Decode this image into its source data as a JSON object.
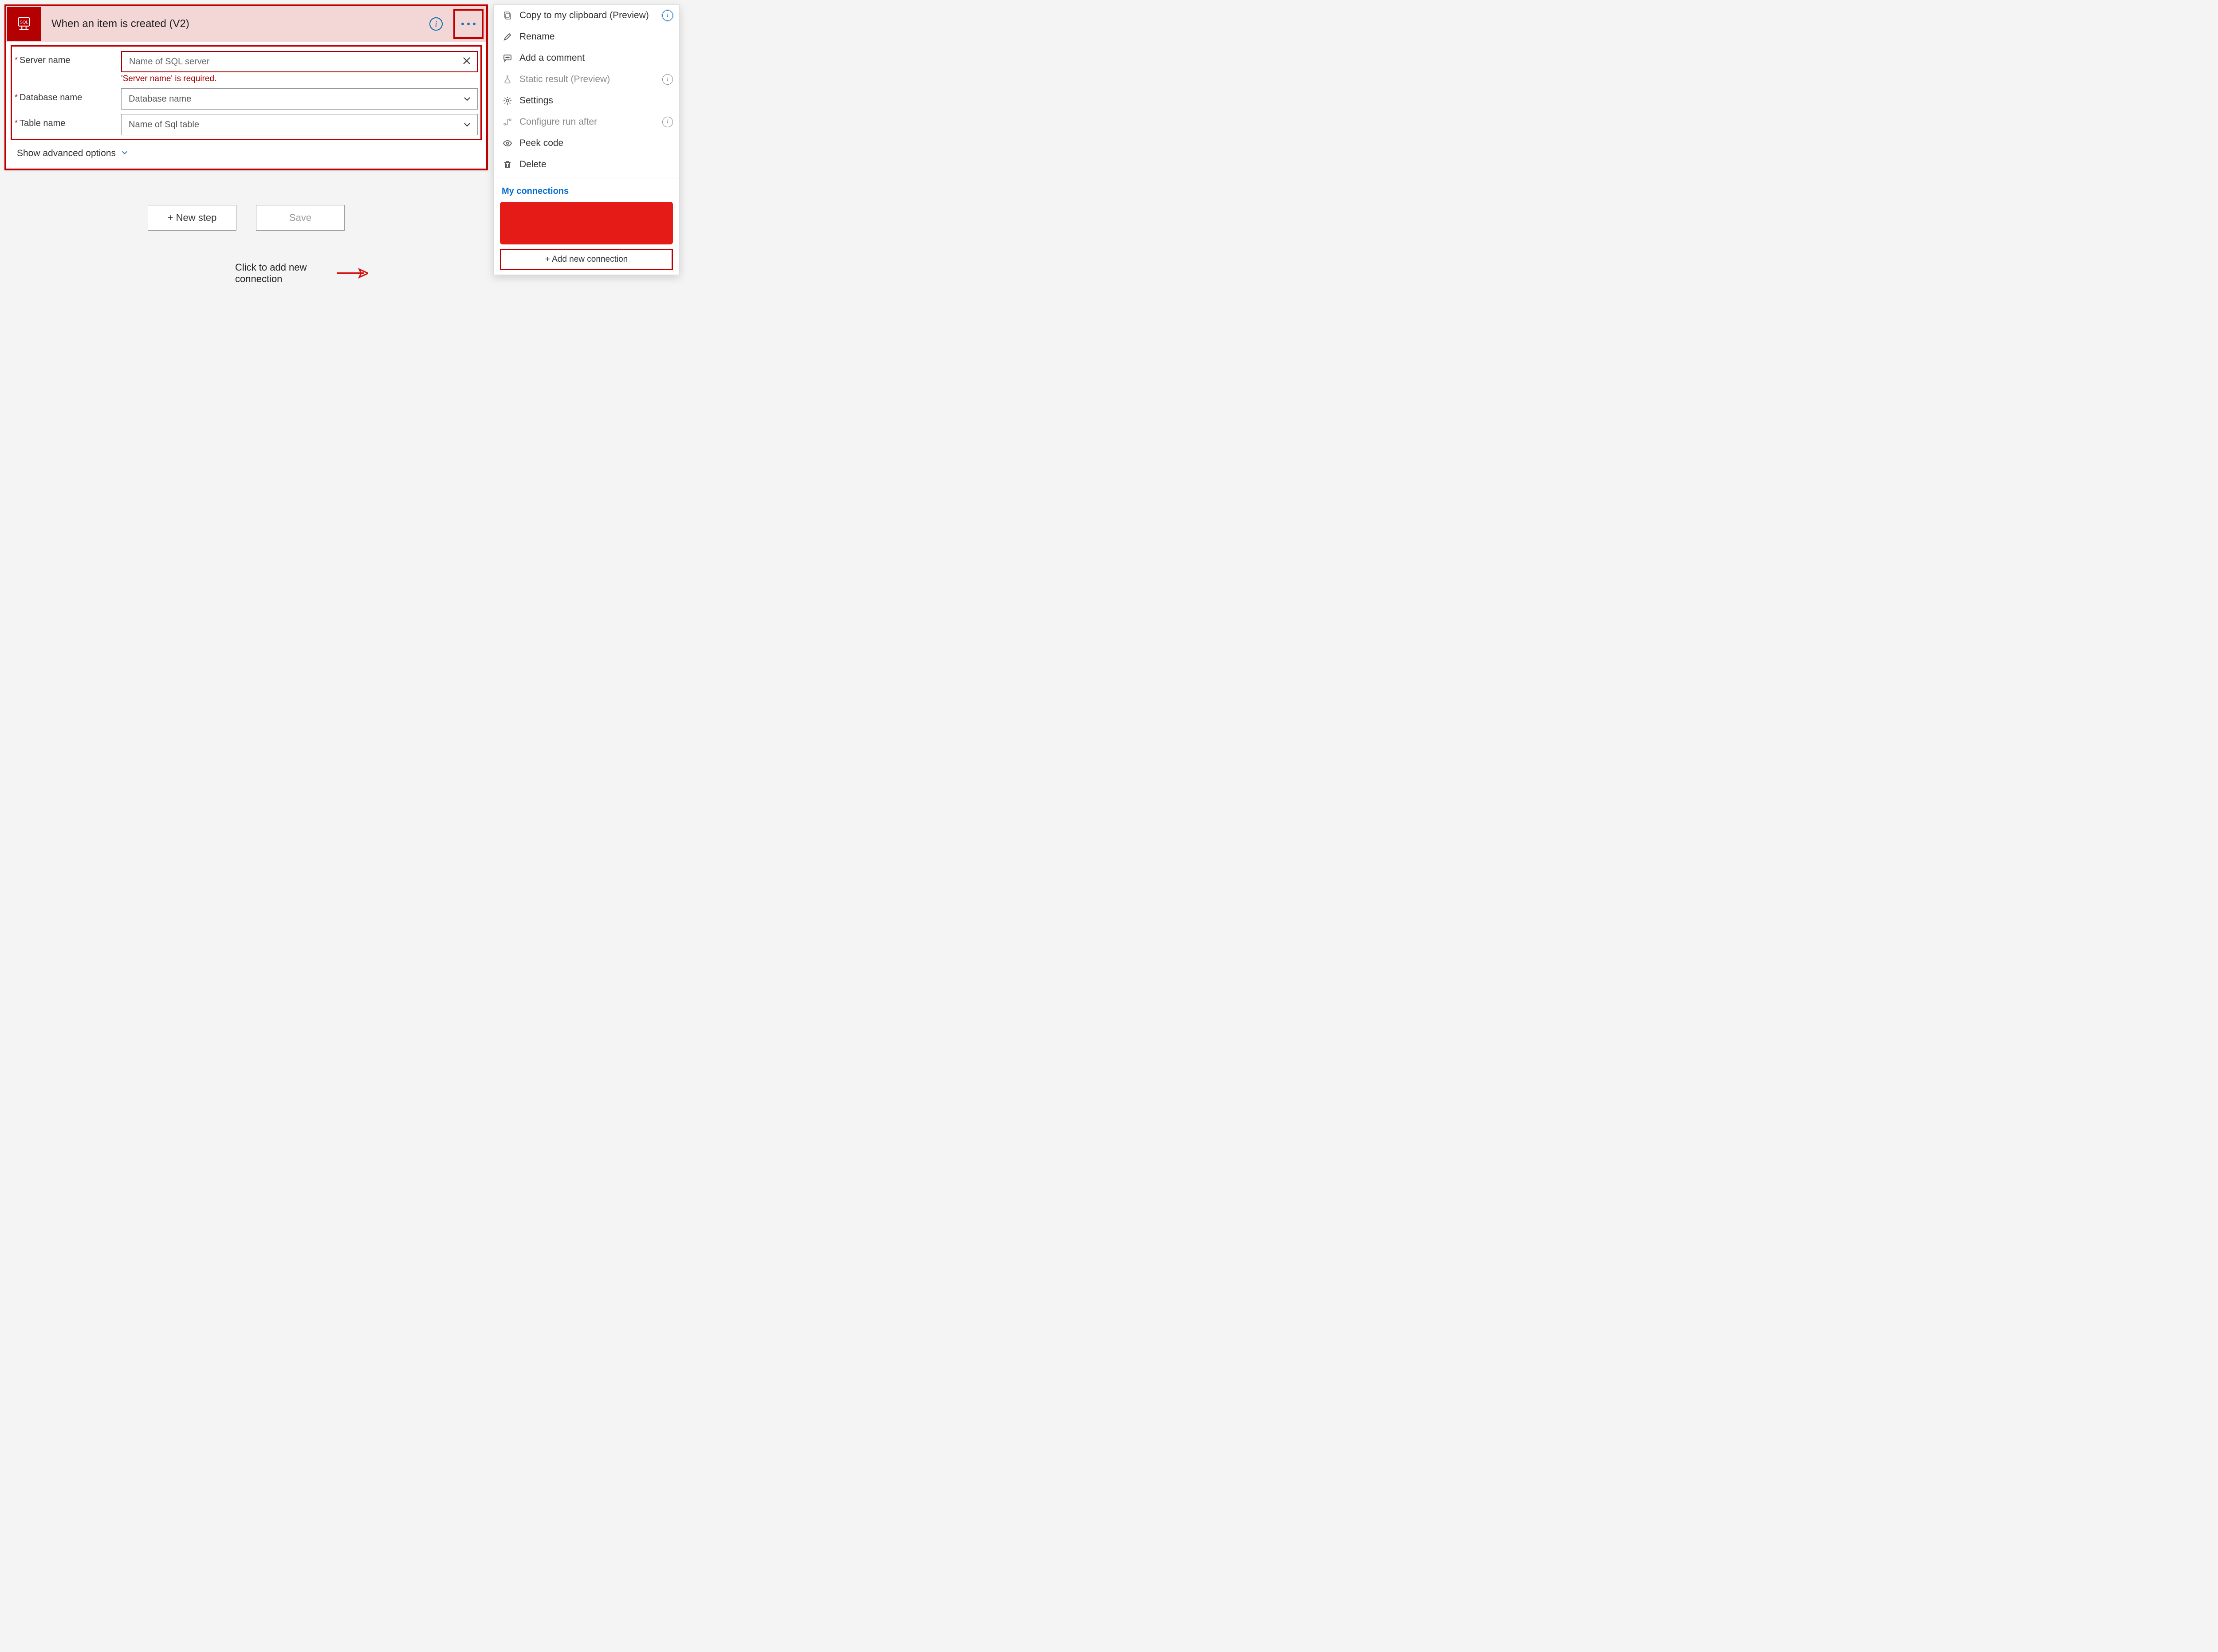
{
  "trigger": {
    "title": "When an item is created (V2)",
    "fields": {
      "server": {
        "label": "Server name",
        "placeholder": "Name of SQL server",
        "error": "'Server name' is required."
      },
      "database": {
        "label": "Database name",
        "placeholder": "Database name"
      },
      "table": {
        "label": "Table name",
        "placeholder": "Name of Sql table"
      }
    },
    "advanced_toggle": "Show advanced options"
  },
  "buttons": {
    "new_step": "+ New step",
    "save": "Save"
  },
  "annotation": {
    "text": "Click to add new connection"
  },
  "context_menu": {
    "items": {
      "copy": "Copy to my clipboard (Preview)",
      "rename": "Rename",
      "comment": "Add a comment",
      "static_result": "Static result (Preview)",
      "settings": "Settings",
      "run_after": "Configure run after",
      "peek": "Peek code",
      "delete": "Delete"
    },
    "connections_heading": "My connections",
    "add_connection": "+ Add new connection"
  }
}
